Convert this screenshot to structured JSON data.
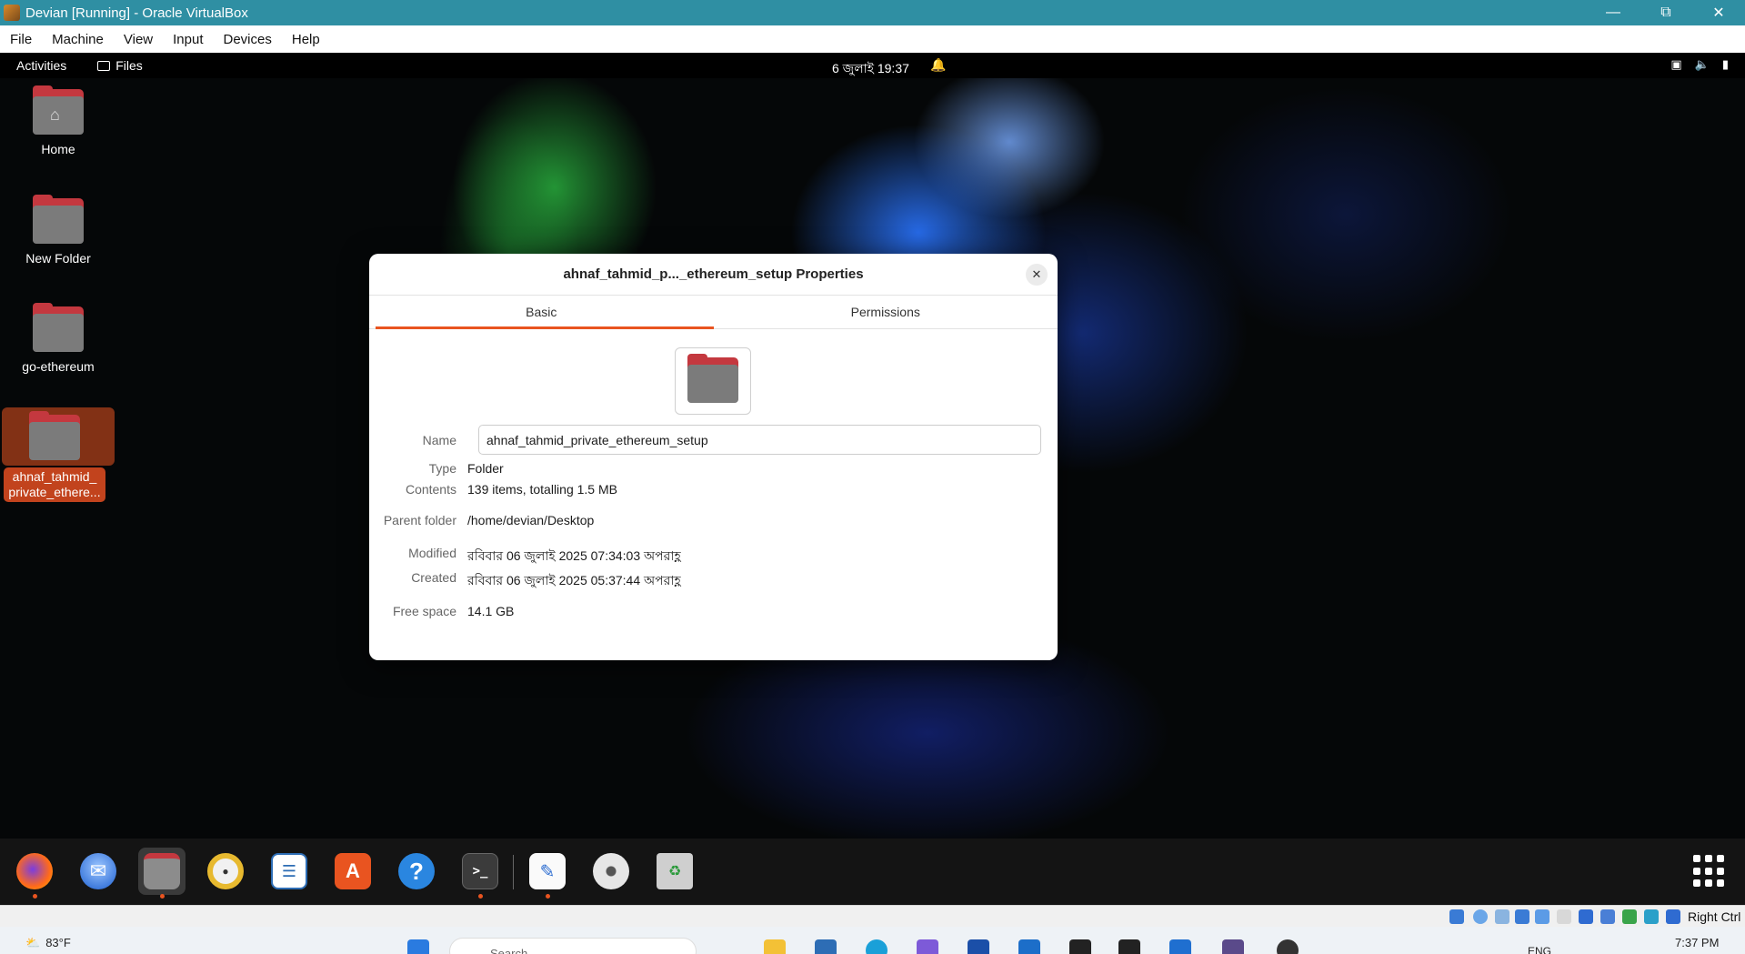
{
  "vbox": {
    "title": "Devian [Running] - Oracle VirtualBox",
    "menu": [
      "File",
      "Machine",
      "View",
      "Input",
      "Devices",
      "Help"
    ],
    "host_key": "Right Ctrl"
  },
  "topbar": {
    "activities": "Activities",
    "files": "Files",
    "clock": "6 জুলাই  19:37"
  },
  "desktop": {
    "icons": [
      {
        "label": "Home"
      },
      {
        "label": "New Folder"
      },
      {
        "label": "go-ethereum"
      },
      {
        "label": "ahnaf_tahmid_\nprivate_ethere..."
      }
    ]
  },
  "dialog": {
    "title": "ahnaf_tahmid_p..._ethereum_setup Properties",
    "tabs": [
      "Basic",
      "Permissions"
    ],
    "name_label": "Name",
    "name_value": "ahnaf_tahmid_private_ethereum_setup",
    "type_label": "Type",
    "type_value": "Folder",
    "contents_label": "Contents",
    "contents_value": "139 items, totalling 1.5 MB",
    "parent_label": "Parent folder",
    "parent_value": "/home/devian/Desktop",
    "modified_label": "Modified",
    "modified_value": "রবিবার 06 জুলাই 2025 07:34:03 অপরাহ্ণ",
    "created_label": "Created",
    "created_value": "রবিবার 06 জুলাই 2025 05:37:44 অপরাহ্ণ",
    "free_label": "Free space",
    "free_value": "14.1 GB"
  },
  "dock": {
    "apps": [
      "firefox-icon",
      "thunderbird-icon",
      "files-icon",
      "rhythmbox-icon",
      "writer-icon",
      "app-center-icon",
      "help-icon",
      "terminal-icon",
      "text-editor-icon",
      "disc-icon",
      "trash-icon"
    ]
  },
  "win_taskbar": {
    "temperature": "83°F",
    "search_placeholder": "Search",
    "language": "ENG",
    "time": "7:37 PM"
  },
  "colors": {
    "accent": "#e95420",
    "folder_red": "#c4383f",
    "vbox_titlebar": "#2f8fa3"
  }
}
